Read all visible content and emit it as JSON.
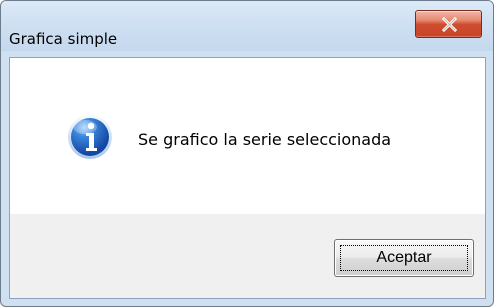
{
  "dialog": {
    "title": "Grafica simple",
    "message": "Se grafico la serie seleccionada",
    "icon": "information-icon",
    "close_icon": "close-icon",
    "buttons": {
      "accept": "Aceptar"
    }
  },
  "colors": {
    "titlebar": "#CFE0F2",
    "close_button": "#C8452A",
    "content_background": "#FFFFFF",
    "button_area_background": "#F0F0F0",
    "info_icon_blue": "#2E6FC4"
  }
}
